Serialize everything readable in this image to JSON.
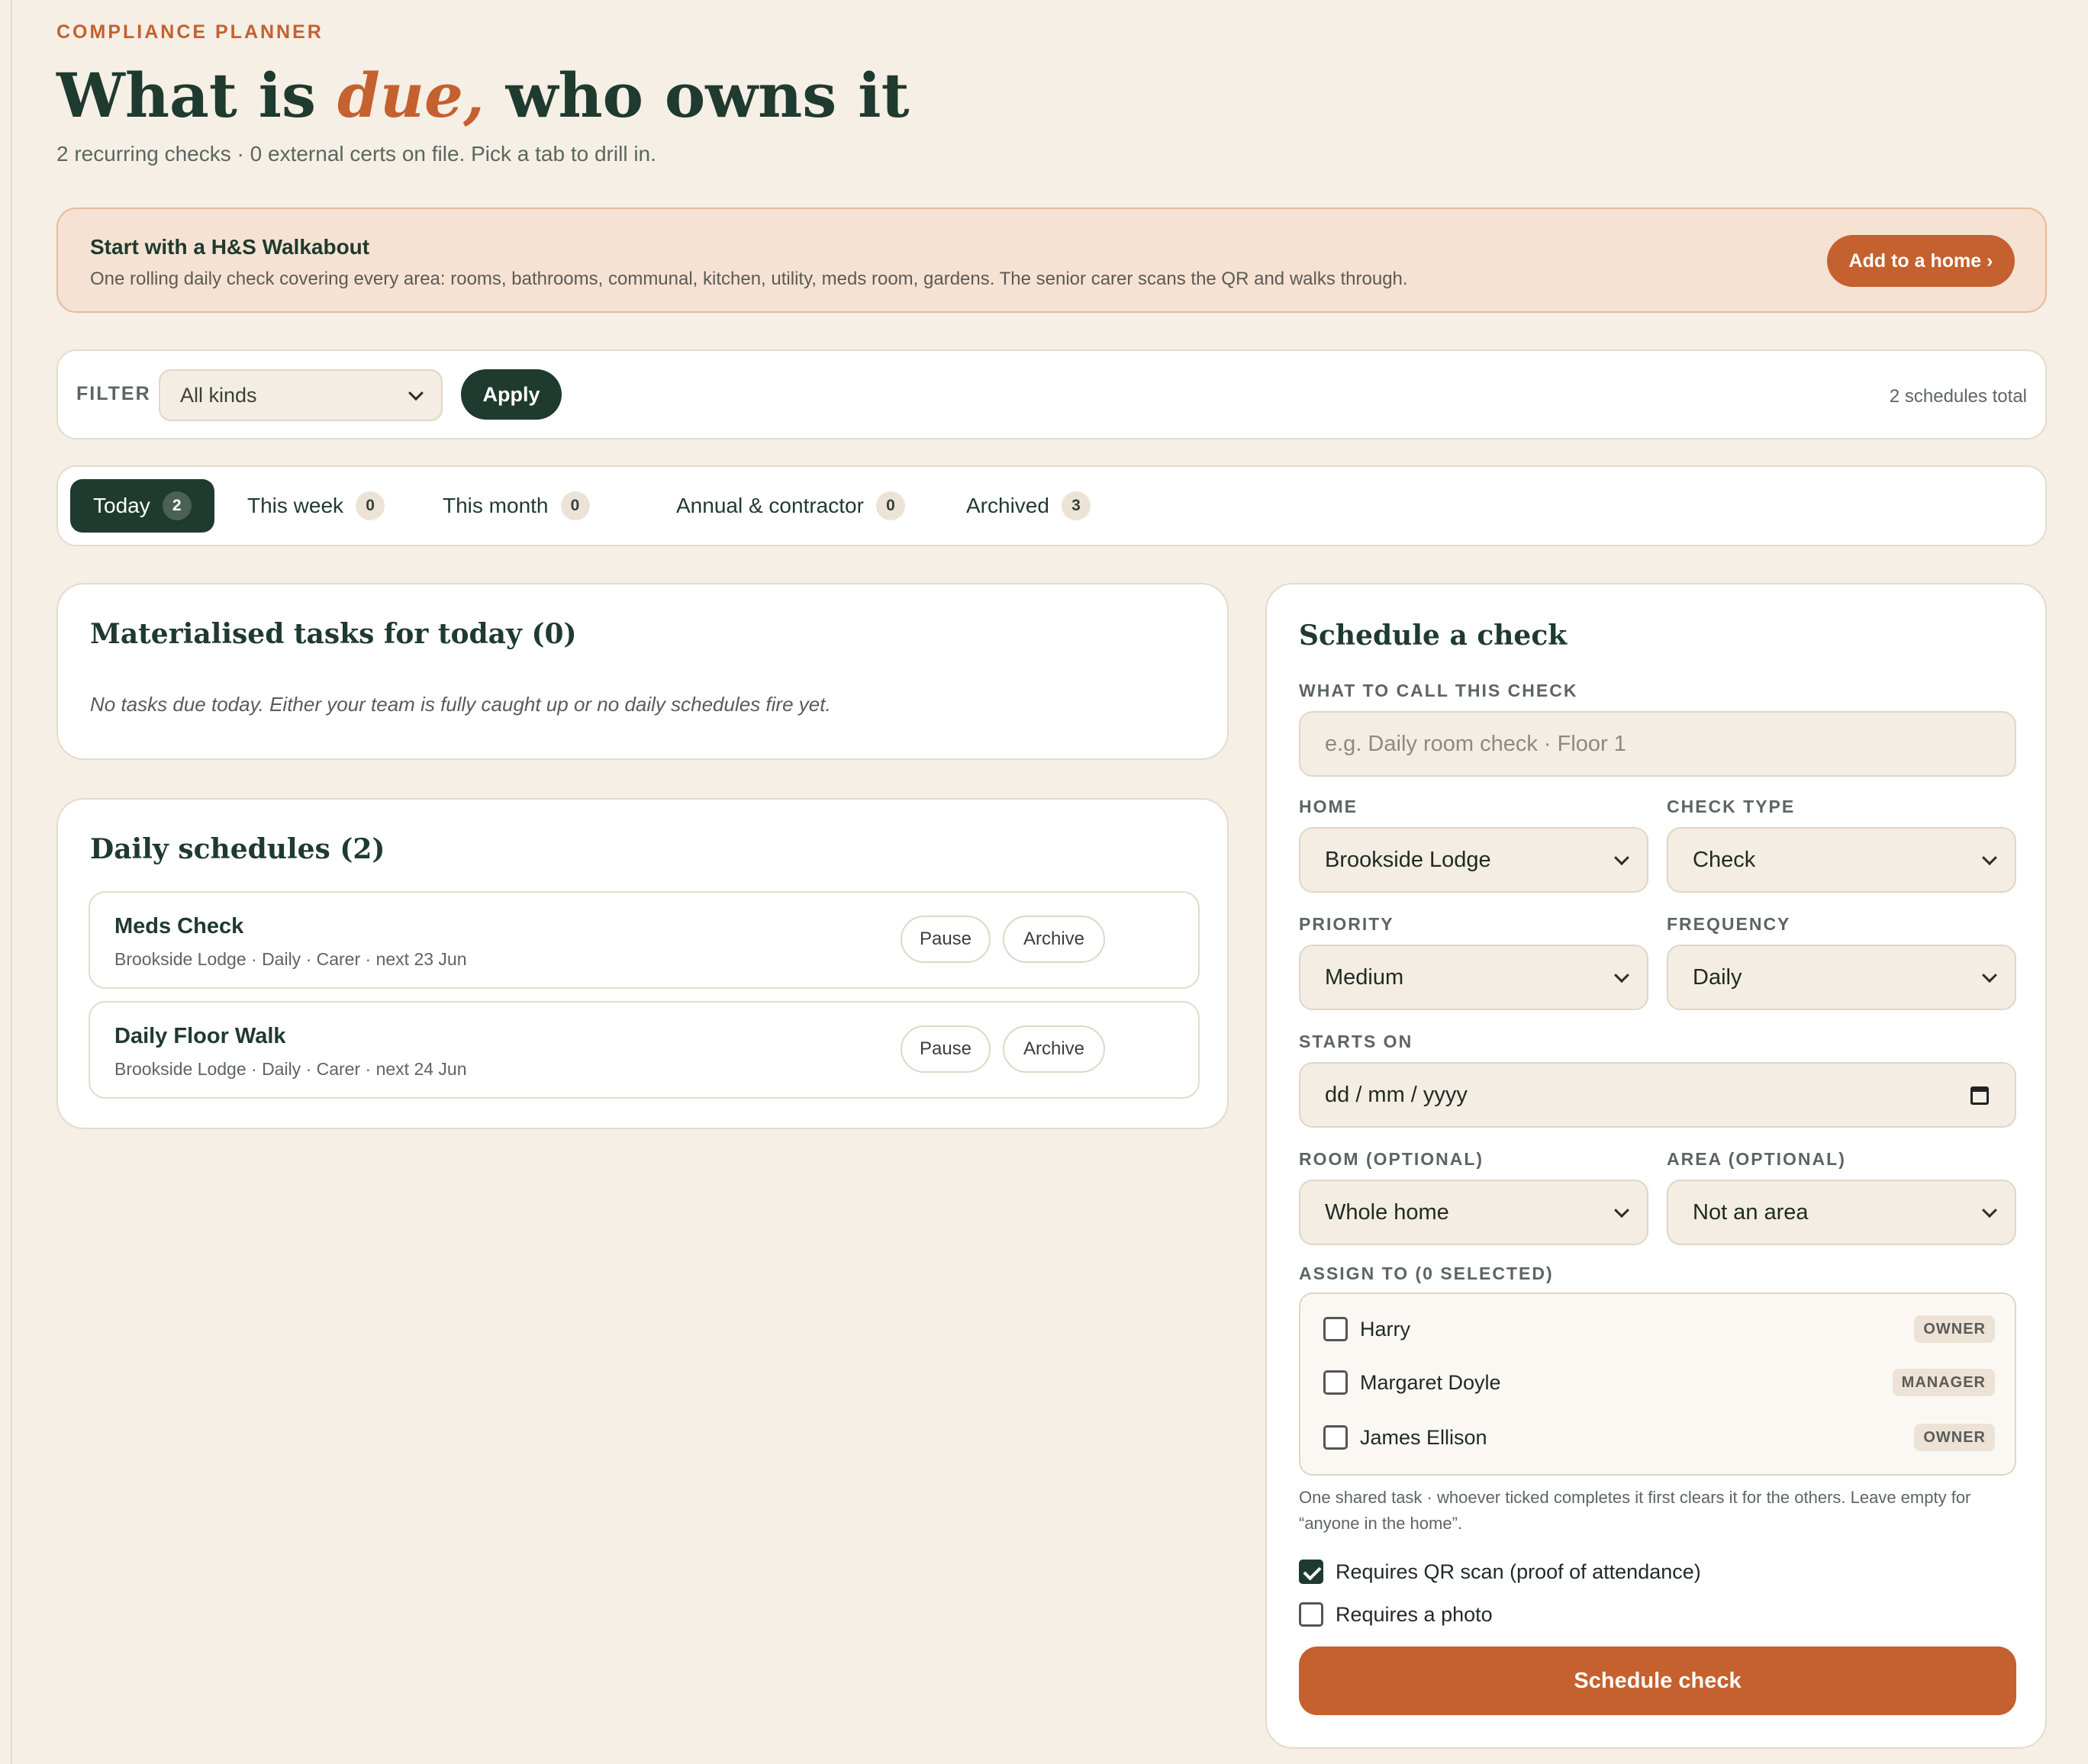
{
  "header": {
    "eyebrow": "COMPLIANCE PLANNER",
    "title_pre": "What is ",
    "title_accent": "due,",
    "title_post": " who owns it",
    "subtitle": "2 recurring checks · 0 external certs on file. Pick a tab to drill in."
  },
  "banner": {
    "title": "Start with a H&S Walkabout",
    "description": "One rolling daily check covering every area: rooms, bathrooms, communal, kitchen, utility, meds room, gardens. The senior carer scans the QR and walks through.",
    "button": "Add to a home ›"
  },
  "filter": {
    "label": "FILTER",
    "selected": "All kinds",
    "apply": "Apply",
    "total": "2 schedules total"
  },
  "tabs": [
    {
      "label": "Today",
      "count": "2"
    },
    {
      "label": "This week",
      "count": "0"
    },
    {
      "label": "This month",
      "count": "0"
    },
    {
      "label": "Annual & contractor",
      "count": "0"
    },
    {
      "label": "Archived",
      "count": "3"
    }
  ],
  "tasks_today": {
    "title": "Materialised tasks for today (0)",
    "empty": "No tasks due today. Either your team is fully caught up or no daily schedules fire yet."
  },
  "daily_schedules": {
    "title": "Daily schedules (2)",
    "pause_label": "Pause",
    "archive_label": "Archive",
    "items": [
      {
        "name": "Meds Check",
        "meta": "Brookside Lodge · Daily · Carer · next 23 Jun"
      },
      {
        "name": "Daily Floor Walk",
        "meta": "Brookside Lodge · Daily · Carer · next 24 Jun"
      }
    ]
  },
  "schedule_form": {
    "title": "Schedule a check",
    "name_label": "WHAT TO CALL THIS CHECK",
    "name_placeholder": "e.g. Daily room check · Floor 1",
    "home_label": "HOME",
    "home_value": "Brookside Lodge",
    "type_label": "CHECK TYPE",
    "type_value": "Check",
    "priority_label": "PRIORITY",
    "priority_value": "Medium",
    "frequency_label": "FREQUENCY",
    "frequency_value": "Daily",
    "starts_label": "STARTS ON",
    "starts_value": "dd / mm / yyyy",
    "room_label": "ROOM (OPTIONAL)",
    "room_value": "Whole home",
    "area_label": "AREA (OPTIONAL)",
    "area_value": "Not an area",
    "assign_label": "ASSIGN TO (0 SELECTED)",
    "assignees": [
      {
        "name": "Harry",
        "role": "OWNER"
      },
      {
        "name": "Margaret Doyle",
        "role": "MANAGER"
      },
      {
        "name": "James Ellison",
        "role": "OWNER"
      }
    ],
    "assign_help": "One shared task · whoever ticked completes it first clears it for the others. Leave empty for “anyone in the home”.",
    "qr_label": "Requires QR scan (proof of attendance)",
    "qr_checked": true,
    "photo_label": "Requires a photo",
    "photo_checked": false,
    "submit": "Schedule check"
  }
}
